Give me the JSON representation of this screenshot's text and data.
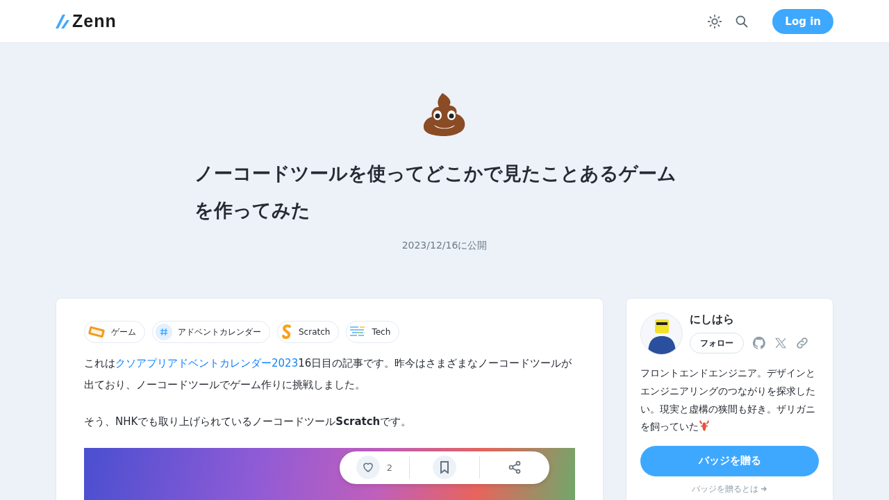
{
  "header": {
    "logo_text": "Zenn",
    "login_button": "Log in"
  },
  "article": {
    "title": "ノーコードツールを使ってどこかで見たことあるゲームを作ってみた",
    "published": "2023/12/16に公開"
  },
  "tags": [
    {
      "kind": "game",
      "label": "ゲーム"
    },
    {
      "kind": "hash",
      "label": "アドベントカレンダー"
    },
    {
      "kind": "scratch",
      "label": "Scratch"
    },
    {
      "kind": "tech",
      "label": "Tech"
    }
  ],
  "body": [
    {
      "kind": "linked",
      "before": "これは",
      "link": "クソアプリアドベントカレンダー2023",
      "after": "16日目の記事です。昨今はさまざまなノーコードツールが出ており、ノーコードツールでゲーム作りに挑戦しました。"
    },
    {
      "kind": "rich",
      "text": "そう、NHKでも取り上げられているノーコードツール**Scratch**です。"
    }
  ],
  "action_bar": {
    "like_count": "2"
  },
  "author": {
    "name": "にしはら",
    "follow_button": "フォロー",
    "bio": "フロントエンドエンジニア。デザインとエンジニアリングのつながりを探求したい。現実と虚構の狭間も好き。ザリガニを飼っていた",
    "badge_button": "バッジを贈る",
    "badge_link": "バッジを贈るとは"
  }
}
